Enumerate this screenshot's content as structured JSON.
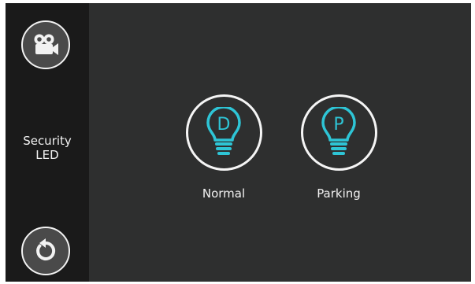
{
  "sidebar": {
    "title_line1": "Security",
    "title_line2": "LED",
    "top_icon": "video-camera-icon",
    "bottom_icon": "refresh-back-icon"
  },
  "modes": [
    {
      "label": "Normal",
      "letter": "D",
      "icon": "bulb-icon"
    },
    {
      "label": "Parking",
      "letter": "P",
      "icon": "bulb-icon"
    }
  ],
  "colors": {
    "background": "#2e2f2f",
    "sidebar": "#1a1a1a",
    "accent": "#2ec5d6",
    "text": "#f2f2f2"
  }
}
